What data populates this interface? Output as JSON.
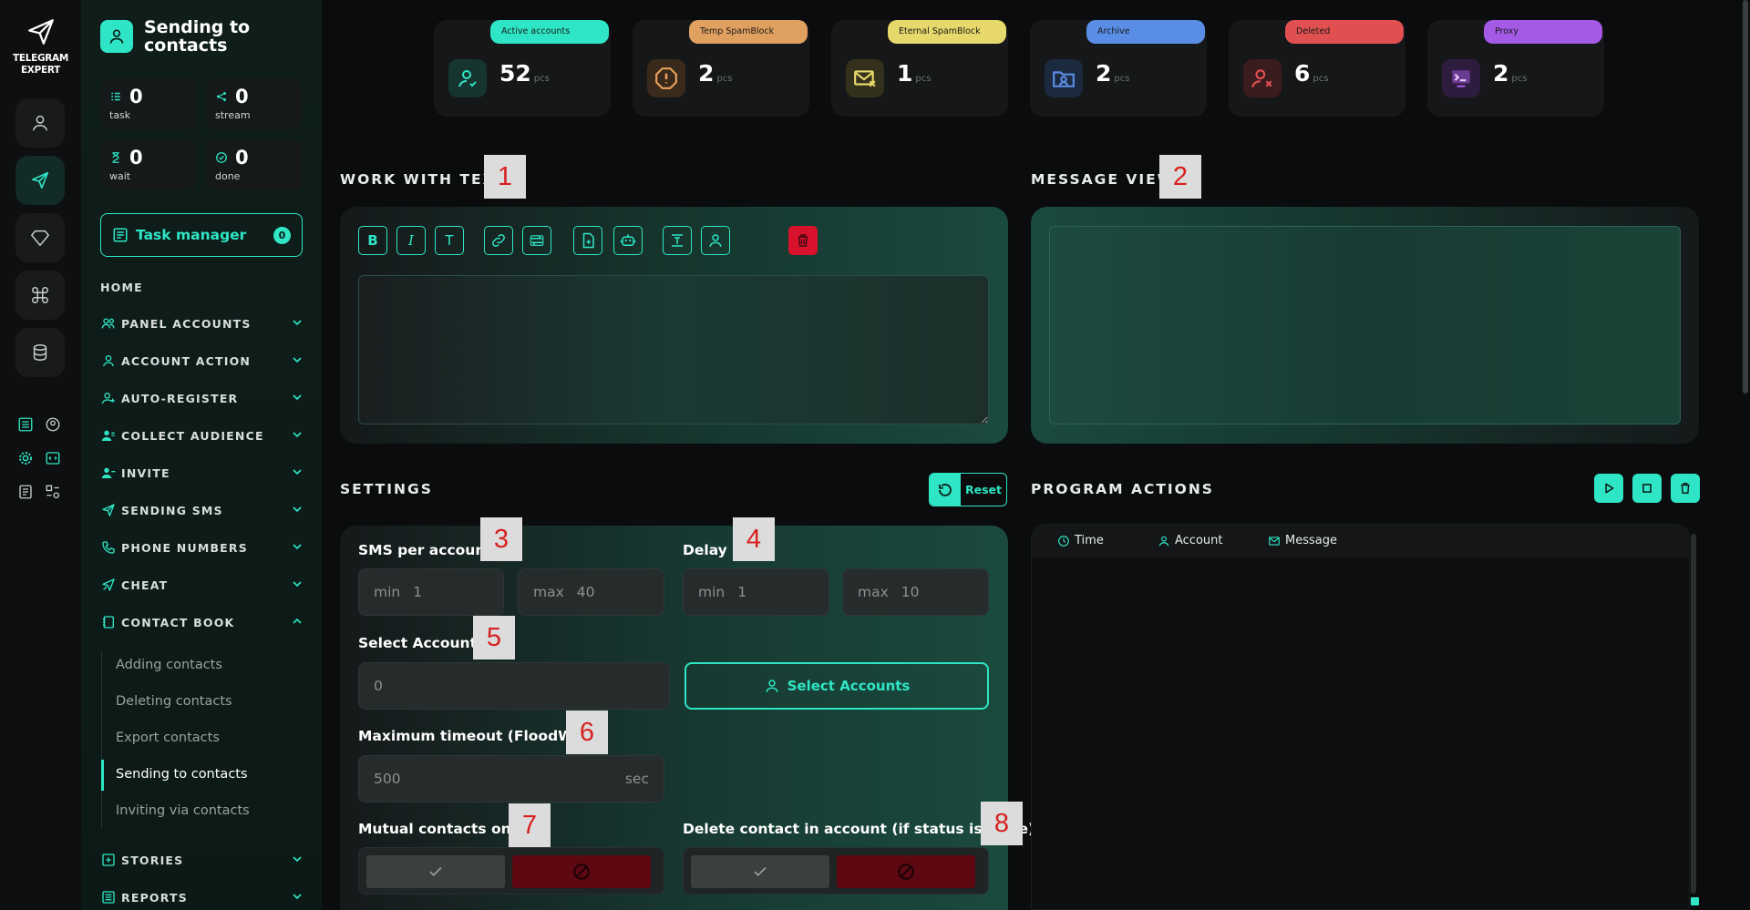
{
  "brand": {
    "line1": "TELEGRAM",
    "line2": "EXPERT"
  },
  "sidebar": {
    "title": "Sending to contacts",
    "stats": [
      {
        "value": "0",
        "label": "task",
        "icon": "list-icon"
      },
      {
        "value": "0",
        "label": "stream",
        "icon": "share-icon"
      },
      {
        "value": "0",
        "label": "wait",
        "icon": "hourglass-icon"
      },
      {
        "value": "0",
        "label": "done",
        "icon": "check-circle-icon"
      }
    ],
    "task_manager": {
      "label": "Task manager",
      "count": "0"
    },
    "home": "HOME",
    "nav": [
      {
        "label": "PANEL ACCOUNTS",
        "icon": "users-icon"
      },
      {
        "label": "ACCOUNT ACTION",
        "icon": "user-icon"
      },
      {
        "label": "AUTO-REGISTER",
        "icon": "user-plus-icon"
      },
      {
        "label": "COLLECT AUDIENCE",
        "icon": "audience-icon"
      },
      {
        "label": "INVITE",
        "icon": "invite-icon"
      },
      {
        "label": "SENDING SMS",
        "icon": "send-icon"
      },
      {
        "label": "PHONE NUMBERS",
        "icon": "phone-icon"
      },
      {
        "label": "CHEAT",
        "icon": "cheat-icon"
      },
      {
        "label": "CONTACT BOOK",
        "icon": "book-icon"
      }
    ],
    "contact_book_items": [
      "Adding contacts",
      "Deleting contacts",
      "Export contacts",
      "Sending to contacts",
      "Inviting via contacts"
    ],
    "nav_bottom": [
      {
        "label": "STORIES",
        "icon": "plus-square-icon"
      },
      {
        "label": "REPORTS",
        "icon": "report-icon"
      }
    ]
  },
  "cards": [
    {
      "label": "Active accounts",
      "value": "52",
      "unit": "pcs",
      "color": "#2ee6c5"
    },
    {
      "label": "Temp SpamBlock",
      "value": "2",
      "unit": "pcs",
      "color": "#e8a05a"
    },
    {
      "label": "Eternal SpamBlock",
      "value": "1",
      "unit": "pcs",
      "color": "#e6d86a"
    },
    {
      "label": "Archive",
      "value": "2",
      "unit": "pcs",
      "color": "#5a8de6"
    },
    {
      "label": "Deleted",
      "value": "6",
      "unit": "pcs",
      "color": "#e05050"
    },
    {
      "label": "Proxy",
      "value": "2",
      "unit": "pcs",
      "color": "#a55ae6"
    }
  ],
  "sections": {
    "work_with_text": "WORK WITH TEXT",
    "message_view": "MESSAGE VIEW",
    "settings": "SETTINGS",
    "program_actions": "PROGRAM ACTIONS"
  },
  "markers": [
    "1",
    "2",
    "3",
    "4",
    "5",
    "6",
    "7",
    "8"
  ],
  "toolbar": {
    "bold": "B",
    "italic": "I",
    "text": "T"
  },
  "settings": {
    "reset": "Reset",
    "sms_label": "SMS per account",
    "sms_min_key": "min",
    "sms_min": "1",
    "sms_max_key": "max",
    "sms_max": "40",
    "delay_label": "Delay",
    "delay_min_key": "min",
    "delay_min": "1",
    "delay_max_key": "max",
    "delay_max": "10",
    "select_label": "Select Accounts",
    "select_value": "0",
    "select_button": "Select Accounts",
    "timeout_label": "Maximum timeout (FloodWait)",
    "timeout_value": "500",
    "timeout_unit": "sec",
    "mutual_label": "Mutual contacts only",
    "delete_label": "Delete contact in account (if status is Done)"
  },
  "log": {
    "col_time": "Time",
    "col_account": "Account",
    "col_message": "Message"
  }
}
